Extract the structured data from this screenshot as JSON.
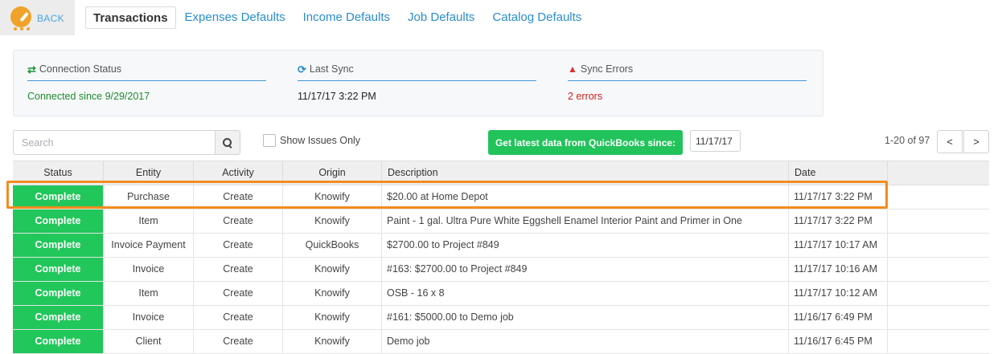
{
  "nav": {
    "back_label": "BACK",
    "tabs": [
      {
        "label": "Transactions",
        "active": true
      },
      {
        "label": "Expenses Defaults",
        "active": false
      },
      {
        "label": "Income Defaults",
        "active": false
      },
      {
        "label": "Job Defaults",
        "active": false
      },
      {
        "label": "Catalog Defaults",
        "active": false
      }
    ]
  },
  "status_panel": {
    "connection": {
      "label": "Connection Status",
      "value": "Connected since 9/29/2017",
      "icon": "exchange-icon"
    },
    "last_sync": {
      "label": "Last Sync",
      "value": "11/17/17 3:22 PM",
      "icon": "refresh-icon"
    },
    "sync_errors": {
      "label": "Sync Errors",
      "value": "2 errors",
      "icon": "warning-icon"
    }
  },
  "toolbar": {
    "search_placeholder": "Search",
    "search_value": "",
    "show_issues_label": "Show Issues Only",
    "show_issues_checked": false,
    "quickbooks_button_label": "Get latest data from QuickBooks since:",
    "since_date_value": "11/17/17",
    "pager_text": "1-20 of 97",
    "prev_label": "<",
    "next_label": ">"
  },
  "table": {
    "columns": [
      "Status",
      "Entity",
      "Activity",
      "Origin",
      "Description",
      "Date"
    ],
    "rows": [
      {
        "status": "Complete",
        "entity": "Purchase",
        "activity": "Create",
        "origin": "Knowify",
        "description": "$20.00 at Home Depot",
        "date": "11/17/17 3:22 PM"
      },
      {
        "status": "Complete",
        "entity": "Item",
        "activity": "Create",
        "origin": "Knowify",
        "description": "Paint - 1 gal. Ultra Pure White Eggshell Enamel Interior Paint and Primer in One",
        "date": "11/17/17 3:22 PM"
      },
      {
        "status": "Complete",
        "entity": "Invoice Payment",
        "activity": "Create",
        "origin": "QuickBooks",
        "description": "$2700.00 to Project #849",
        "date": "11/17/17 10:17 AM"
      },
      {
        "status": "Complete",
        "entity": "Invoice",
        "activity": "Create",
        "origin": "Knowify",
        "description": "#163: $2700.00 to Project #849",
        "date": "11/17/17 10:16 AM"
      },
      {
        "status": "Complete",
        "entity": "Item",
        "activity": "Create",
        "origin": "Knowify",
        "description": "OSB - 16 x 8",
        "date": "11/17/17 10:12 AM"
      },
      {
        "status": "Complete",
        "entity": "Invoice",
        "activity": "Create",
        "origin": "Knowify",
        "description": "#161: $5000.00 to Demo job",
        "date": "11/16/17 6:49 PM"
      },
      {
        "status": "Complete",
        "entity": "Client",
        "activity": "Create",
        "origin": "Knowify",
        "description": "Demo job",
        "date": "11/16/17 6:45 PM"
      }
    ]
  },
  "colors": {
    "accent_blue": "#2a8dd0",
    "status_green": "#21c75a",
    "highlight_orange": "#f28c1e",
    "error_red": "#d4201c",
    "logo_orange": "#f0a32a"
  }
}
